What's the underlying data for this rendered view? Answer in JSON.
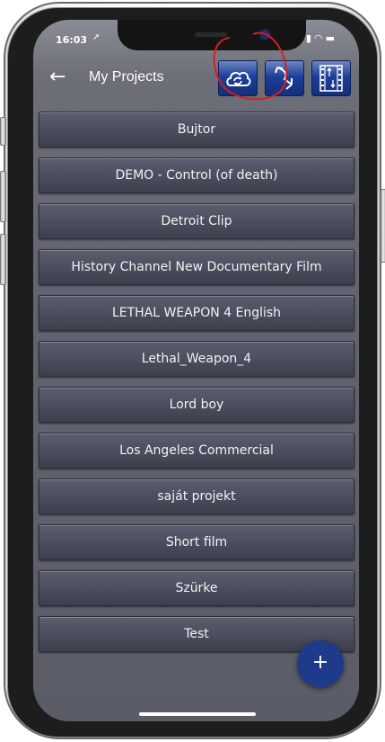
{
  "status_bar": {
    "time": "16:03",
    "location_icon": "location-arrow-icon",
    "right_icons": [
      "signal-icon",
      "wifi-icon",
      "battery-icon"
    ]
  },
  "header": {
    "back_icon": "arrow-left-icon",
    "title": "My Projects",
    "buttons": [
      {
        "name": "cloud-sync-button",
        "icon": "cloud-sync-icon"
      },
      {
        "name": "direction-button",
        "icon": "direction-arrows-icon"
      },
      {
        "name": "film-sort-button",
        "icon": "film-sort-icon"
      }
    ]
  },
  "projects": [
    "Bujtor",
    "DEMO - Control (of death)",
    "Detroit Clip",
    "History Channel New Documentary Film",
    "LETHAL WEAPON 4 English",
    "Lethal_Weapon_4",
    "Lord boy",
    "Los Angeles Commercial",
    "saját projekt",
    "Short film",
    "Szürke",
    "Test"
  ],
  "fab": {
    "label": "+",
    "icon": "plus-icon"
  },
  "colors": {
    "accent": "#1e3a8a",
    "button_blue": "#1c3f9a",
    "background": "#62646f",
    "annotation": "#d42020"
  }
}
